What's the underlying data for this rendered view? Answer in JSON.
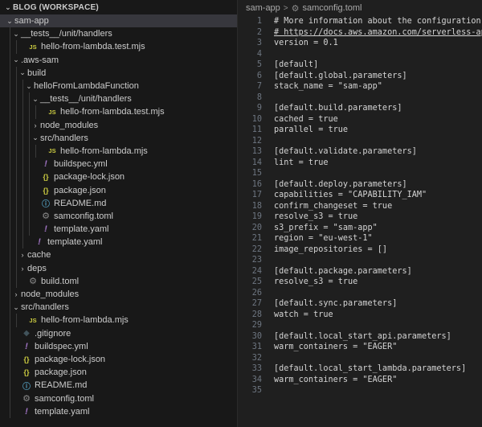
{
  "sidebar": {
    "title": "BLOG (WORKSPACE)",
    "tree": [
      {
        "label": "sam-app",
        "depth": 0,
        "kind": "folder-open",
        "selected": true
      },
      {
        "label": "__tests__/unit/handlers",
        "depth": 1,
        "kind": "folder-open"
      },
      {
        "label": "hello-from-lambda.test.mjs",
        "depth": 2,
        "kind": "js"
      },
      {
        "label": ".aws-sam",
        "depth": 1,
        "kind": "folder-open"
      },
      {
        "label": "build",
        "depth": 2,
        "kind": "folder-open"
      },
      {
        "label": "helloFromLambdaFunction",
        "depth": 3,
        "kind": "folder-open"
      },
      {
        "label": "__tests__/unit/handlers",
        "depth": 4,
        "kind": "folder-open"
      },
      {
        "label": "hello-from-lambda.test.mjs",
        "depth": 5,
        "kind": "js"
      },
      {
        "label": "node_modules",
        "depth": 4,
        "kind": "folder-closed"
      },
      {
        "label": "src/handlers",
        "depth": 4,
        "kind": "folder-open"
      },
      {
        "label": "hello-from-lambda.mjs",
        "depth": 5,
        "kind": "js"
      },
      {
        "label": "buildspec.yml",
        "depth": 4,
        "kind": "yml"
      },
      {
        "label": "package-lock.json",
        "depth": 4,
        "kind": "json"
      },
      {
        "label": "package.json",
        "depth": 4,
        "kind": "json"
      },
      {
        "label": "README.md",
        "depth": 4,
        "kind": "md"
      },
      {
        "label": "samconfig.toml",
        "depth": 4,
        "kind": "gear"
      },
      {
        "label": "template.yaml",
        "depth": 4,
        "kind": "yml"
      },
      {
        "label": "template.yaml",
        "depth": 3,
        "kind": "yml"
      },
      {
        "label": "cache",
        "depth": 2,
        "kind": "folder-closed"
      },
      {
        "label": "deps",
        "depth": 2,
        "kind": "folder-closed"
      },
      {
        "label": "build.toml",
        "depth": 2,
        "kind": "gear"
      },
      {
        "label": "node_modules",
        "depth": 1,
        "kind": "folder-closed"
      },
      {
        "label": "src/handlers",
        "depth": 1,
        "kind": "folder-open"
      },
      {
        "label": "hello-from-lambda.mjs",
        "depth": 2,
        "kind": "js"
      },
      {
        "label": ".gitignore",
        "depth": 1,
        "kind": "git"
      },
      {
        "label": "buildspec.yml",
        "depth": 1,
        "kind": "yml"
      },
      {
        "label": "package-lock.json",
        "depth": 1,
        "kind": "json"
      },
      {
        "label": "package.json",
        "depth": 1,
        "kind": "json"
      },
      {
        "label": "README.md",
        "depth": 1,
        "kind": "md"
      },
      {
        "label": "samconfig.toml",
        "depth": 1,
        "kind": "gear"
      },
      {
        "label": "template.yaml",
        "depth": 1,
        "kind": "yml"
      }
    ]
  },
  "breadcrumb": {
    "folder": "sam-app",
    "separator": ">",
    "file": "samconfig.toml"
  },
  "editor": {
    "lines": [
      "# More information about the configuration file can be found here:",
      "# https://docs.aws.amazon.com/serverless-application-model/latest/developerguide/serverless-sam-cli-config.html",
      "version = 0.1",
      "",
      "[default]",
      "[default.global.parameters]",
      "stack_name = \"sam-app\"",
      "",
      "[default.build.parameters]",
      "cached = true",
      "parallel = true",
      "",
      "[default.validate.parameters]",
      "lint = true",
      "",
      "[default.deploy.parameters]",
      "capabilities = \"CAPABILITY_IAM\"",
      "confirm_changeset = true",
      "resolve_s3 = true",
      "s3_prefix = \"sam-app\"",
      "region = \"eu-west-1\"",
      "image_repositories = []",
      "",
      "[default.package.parameters]",
      "resolve_s3 = true",
      "",
      "[default.sync.parameters]",
      "watch = true",
      "",
      "[default.local_start_api.parameters]",
      "warm_containers = \"EAGER\"",
      "",
      "[default.local_start_lambda.parameters]",
      "warm_containers = \"EAGER\"",
      ""
    ]
  },
  "icons": {
    "folder-open": "chevron-down-icon",
    "folder-closed": "chevron-right-icon",
    "js": "javascript-file-icon",
    "yml": "yaml-file-icon",
    "json": "json-file-icon",
    "md": "info-file-icon",
    "gear": "config-gear-icon",
    "git": "git-file-icon"
  }
}
